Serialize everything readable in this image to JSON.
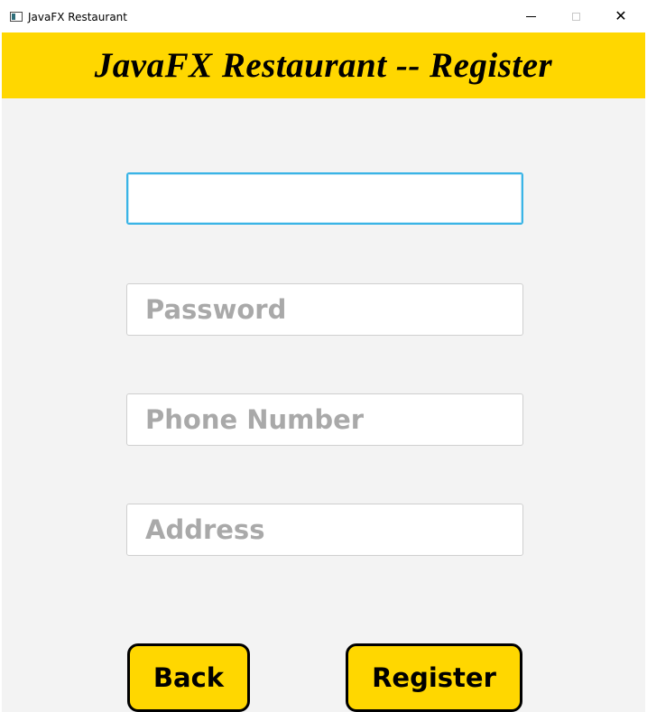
{
  "window": {
    "title": "JavaFX Restaurant",
    "icon": "java-app-icon",
    "controls": [
      "minimize-icon",
      "maximize-icon",
      "close-icon"
    ],
    "close_glyph": "✕"
  },
  "header": {
    "title": "JavaFX Restaurant -- Register",
    "background": "#ffd700"
  },
  "form": {
    "username": {
      "value": "",
      "placeholder": ""
    },
    "password": {
      "value": "",
      "placeholder": "Password"
    },
    "phone": {
      "value": "",
      "placeholder": "Phone Number"
    },
    "address": {
      "value": "",
      "placeholder": "Address"
    }
  },
  "buttons": {
    "back_label": "Back",
    "register_label": "Register"
  },
  "colors": {
    "accent": "#ffd700",
    "focus_border": "#3ab4e6",
    "body_background": "#f3f3f3"
  }
}
